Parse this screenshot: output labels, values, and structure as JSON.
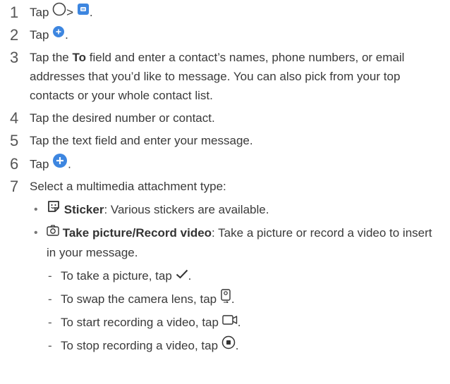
{
  "steps": [
    {
      "num": "1",
      "pre": "Tap",
      "mid": ">",
      "post": "."
    },
    {
      "num": "2",
      "pre": "Tap",
      "post": "."
    },
    {
      "num": "3",
      "pre": "Tap the",
      "bold": "To",
      "rest": "field and enter a contact’s names, phone numbers, or email addresses that you’d like to message. You can also pick from your top contacts or your whole contact list."
    },
    {
      "num": "4",
      "text": "Tap the desired number or contact."
    },
    {
      "num": "5",
      "text": "Tap the text field and enter your message."
    },
    {
      "num": "6",
      "pre": "Tap",
      "post": "."
    },
    {
      "num": "7",
      "text": "Select a multimedia attachment type:"
    }
  ],
  "bullets": [
    {
      "mark": "•",
      "label": "Sticker",
      "desc": ": Various stickers are available."
    },
    {
      "mark": "•",
      "label": "Take picture/Record video",
      "desc": ": Take a picture or record a video to insert in your message."
    }
  ],
  "sub_items": [
    {
      "mark": "-",
      "text": "To take a picture, tap",
      "post": "."
    },
    {
      "mark": "-",
      "text": "To swap the camera lens, tap",
      "post": "."
    },
    {
      "mark": "-",
      "text": "To start recording a video, tap",
      "post": "."
    },
    {
      "mark": "-",
      "text": "To stop recording a video, tap",
      "post": "."
    }
  ],
  "colors": {
    "accent_blue": "#3d86e0",
    "text": "#3a3a3a"
  },
  "icons": [
    "home-circle-icon",
    "messaging-app-icon",
    "new-message-plus-icon",
    "attach-plus-icon",
    "sticker-icon",
    "camera-icon",
    "checkmark-icon",
    "swap-camera-icon",
    "video-record-icon",
    "stop-record-icon"
  ]
}
